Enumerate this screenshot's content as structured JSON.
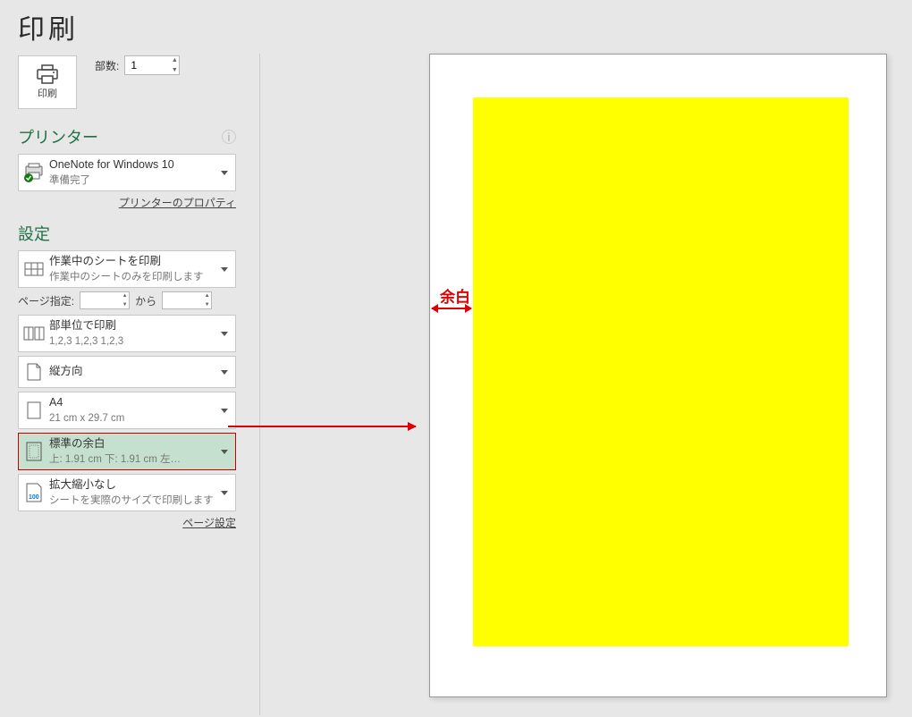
{
  "title": "印刷",
  "print_button_label": "印刷",
  "copies": {
    "label": "部数:",
    "value": "1"
  },
  "printer": {
    "section": "プリンター",
    "name": "OneNote for Windows 10",
    "status": "準備完了",
    "properties_link": "プリンターのプロパティ"
  },
  "settings": {
    "section": "設定",
    "what": {
      "title": "作業中のシートを印刷",
      "sub": "作業中のシートのみを印刷します"
    },
    "pages": {
      "label": "ページ指定:",
      "from": "",
      "to_label": "から",
      "to": ""
    },
    "collate": {
      "title": "部単位で印刷",
      "sub": "1,2,3    1,2,3    1,2,3"
    },
    "orient": {
      "title": "縦方向"
    },
    "paper": {
      "title": "A4",
      "sub": "21 cm x 29.7 cm"
    },
    "margin": {
      "title": "標準の余白",
      "sub": "上: 1.91 cm 下: 1.91 cm 左…"
    },
    "scale": {
      "title": "拡大縮小なし",
      "sub": "シートを実際のサイズで印刷します"
    },
    "page_setup_link": "ページ設定"
  },
  "annotation": {
    "margin_label": "余白"
  }
}
